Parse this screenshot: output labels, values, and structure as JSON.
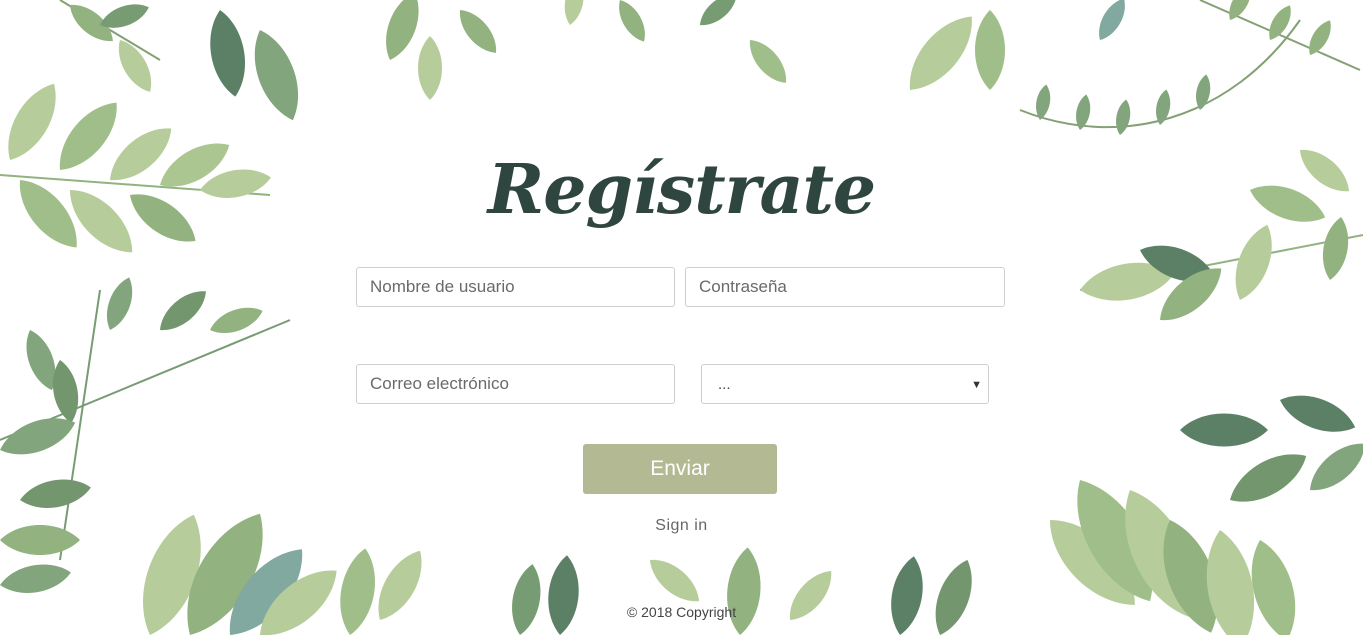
{
  "title": "Regístrate",
  "form": {
    "username_placeholder": "Nombre de usuario",
    "password_placeholder": "Contraseña",
    "email_placeholder": "Correo electrónico",
    "select_value": "...",
    "submit_label": "Enviar"
  },
  "signin_label": "Sign in",
  "footer": {
    "copyright": "© 2018 Copyright"
  },
  "colors": {
    "title": "#2f4540",
    "button": "#b3b992",
    "leaf_light": "#a9c48a",
    "leaf_mid": "#7fa56a",
    "leaf_dark": "#3f6a4a"
  }
}
